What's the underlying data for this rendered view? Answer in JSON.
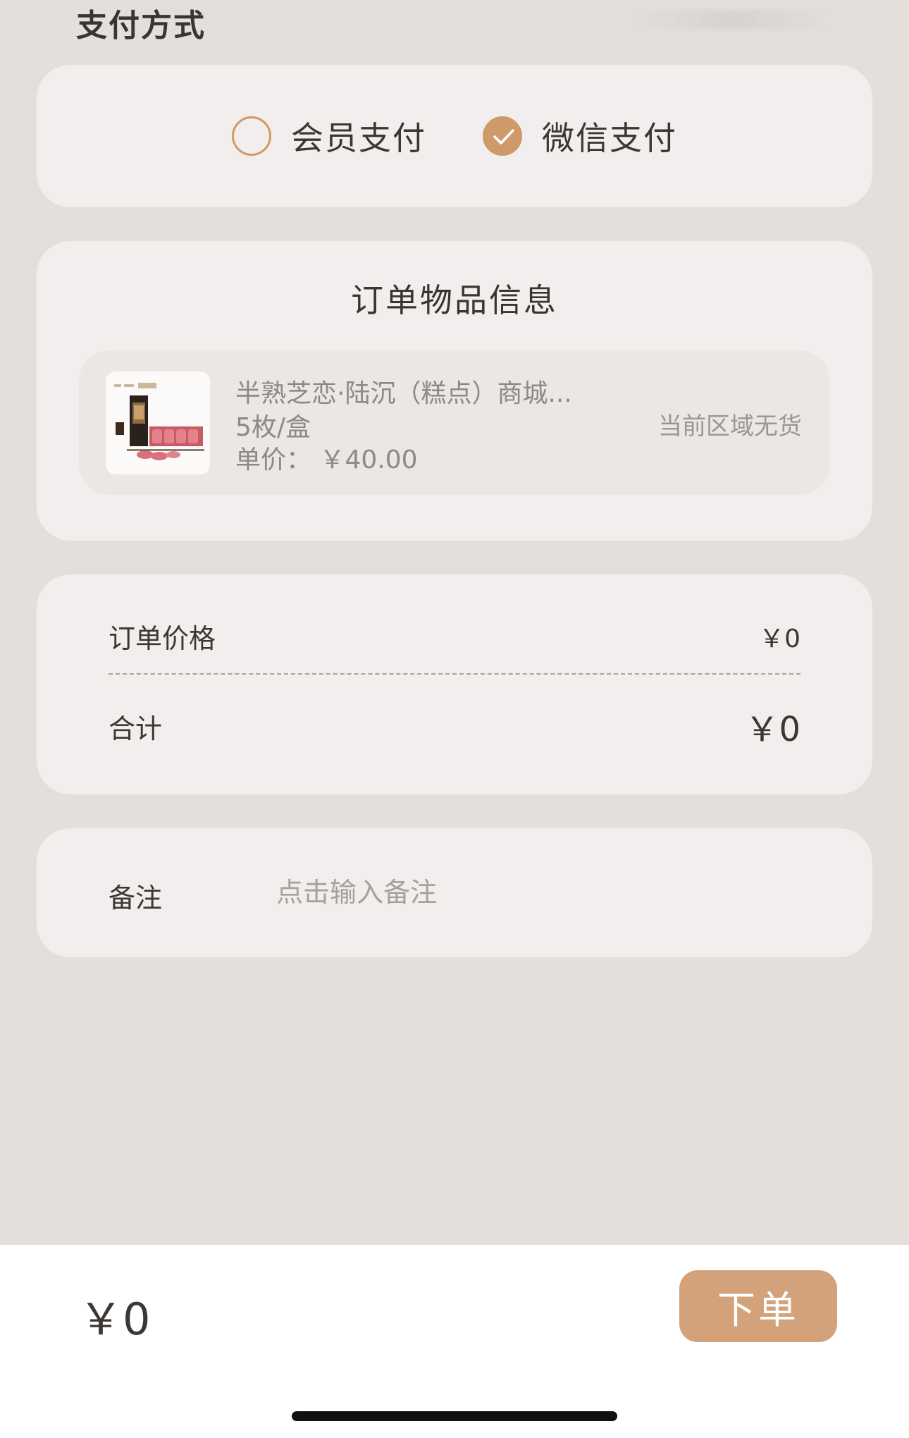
{
  "payment": {
    "section_title": "支付方式",
    "options": [
      {
        "label": "会员支付",
        "selected": false
      },
      {
        "label": "微信支付",
        "selected": true
      }
    ]
  },
  "order": {
    "title": "订单物品信息",
    "item": {
      "name": "半熟芝恋·陆沉（糕点）商城...",
      "spec": "5枚/盒",
      "unit_price": "单价： ￥40.00",
      "stock_status": "当前区域无货"
    }
  },
  "price": {
    "order_price_label": "订单价格",
    "order_price_value": "￥0",
    "total_label": "合计",
    "total_value": "￥0"
  },
  "remark": {
    "label": "备注",
    "placeholder": "点击输入备注"
  },
  "bottom": {
    "total": "￥0",
    "submit_label": "下单"
  },
  "colors": {
    "accent": "#cf9a68",
    "button": "#d3a27a",
    "background": "#e4dfdb",
    "card": "#f2eeed"
  }
}
